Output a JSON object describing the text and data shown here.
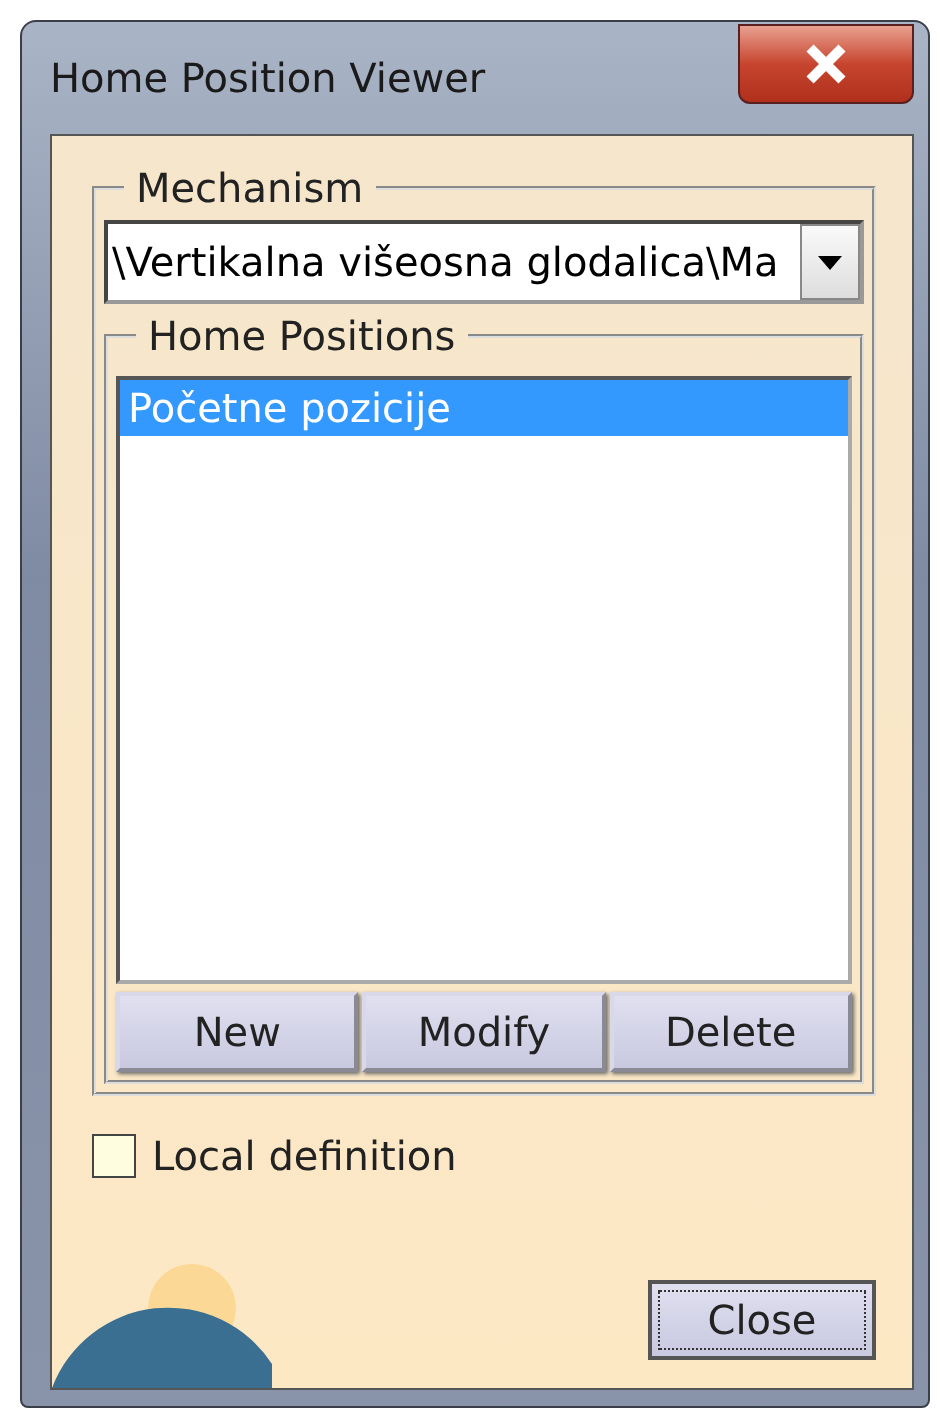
{
  "window": {
    "title": "Home Position Viewer"
  },
  "mechanism": {
    "label": "Mechanism",
    "value": "\\Vertikalna višeosna glodalica\\Ma"
  },
  "home_positions": {
    "label": "Home Positions",
    "items": [
      {
        "label": "Početne pozicije",
        "selected": true
      }
    ],
    "buttons": [
      "New",
      "Modify",
      "Delete"
    ]
  },
  "local_definition": {
    "label": "Local definition",
    "checked": false
  },
  "close_button": {
    "label": "Close"
  }
}
